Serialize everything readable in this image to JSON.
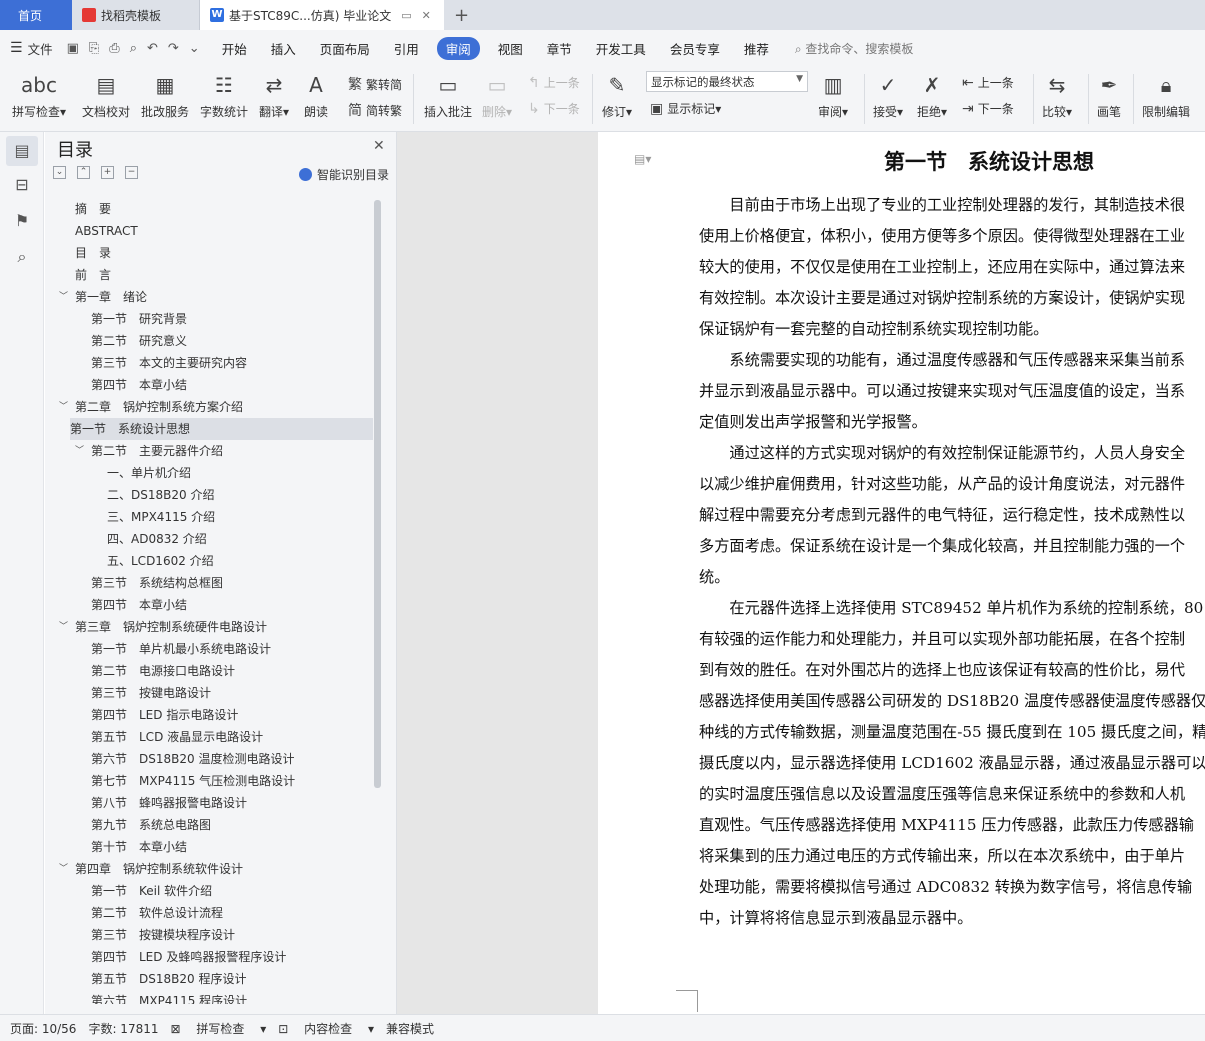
{
  "tabs": {
    "home": "首页",
    "daoke": "找稻壳模板",
    "doc": "基于STC89C...仿真)  毕业论文",
    "add": "+"
  },
  "menu": {
    "file": "文件",
    "items": [
      "开始",
      "插入",
      "页面布局",
      "引用",
      "审阅",
      "视图",
      "章节",
      "开发工具",
      "会员专享",
      "推荐"
    ],
    "active": "审阅",
    "search": "查找命令、搜索模板"
  },
  "ribbon": {
    "spell": "拼写检查",
    "doccheck": "文档校对",
    "batch": "批改服务",
    "wordcount": "字数统计",
    "translate": "翻译",
    "read": "朗读",
    "trad": "繁转简",
    "simp": "简转繁",
    "insert_comment": "插入批注",
    "delete": "删除",
    "prev": "上一条",
    "next": "下一条",
    "revise": "修订",
    "markup_state": "显示标记的最终状态",
    "show_markup": "显示标记",
    "review": "审阅",
    "accept": "接受",
    "reject": "拒绝",
    "prev2": "上一条",
    "next2": "下一条",
    "compare": "比较",
    "pen": "画笔",
    "restrict": "限制编辑"
  },
  "toc": {
    "title": "目录",
    "smart": "智能识别目录",
    "items": [
      {
        "text": "摘　要",
        "level": 0
      },
      {
        "text": "ABSTRACT",
        "level": 0
      },
      {
        "text": "目　录",
        "level": 0
      },
      {
        "text": "前　言",
        "level": 0
      },
      {
        "text": "第一章　绪论",
        "level": 0,
        "expander": true
      },
      {
        "text": "第一节　研究背景",
        "level": 1
      },
      {
        "text": "第二节　研究意义",
        "level": 1
      },
      {
        "text": "第三节　本文的主要研究内容",
        "level": 1
      },
      {
        "text": "第四节　本章小结",
        "level": 1
      },
      {
        "text": "第二章　锅炉控制系统方案介绍",
        "level": 0,
        "expander": true
      },
      {
        "text": "第一节　系统设计思想",
        "level": 1,
        "selected": true
      },
      {
        "text": "第二节　主要元器件介绍",
        "level": 1,
        "expander": true
      },
      {
        "text": "一、单片机介绍",
        "level": 2
      },
      {
        "text": "二、DS18B20 介绍",
        "level": 2
      },
      {
        "text": "三、MPX4115 介绍",
        "level": 2
      },
      {
        "text": "四、AD0832 介绍",
        "level": 2
      },
      {
        "text": "五、LCD1602 介绍",
        "level": 2
      },
      {
        "text": "第三节　系统结构总框图",
        "level": 1
      },
      {
        "text": "第四节　本章小结",
        "level": 1
      },
      {
        "text": "第三章　锅炉控制系统硬件电路设计",
        "level": 0,
        "expander": true
      },
      {
        "text": "第一节　单片机最小系统电路设计",
        "level": 1
      },
      {
        "text": "第二节　电源接口电路设计",
        "level": 1
      },
      {
        "text": "第三节　按键电路设计",
        "level": 1
      },
      {
        "text": "第四节　LED 指示电路设计",
        "level": 1
      },
      {
        "text": "第五节　LCD 液晶显示电路设计",
        "level": 1
      },
      {
        "text": "第六节　DS18B20 温度检测电路设计",
        "level": 1
      },
      {
        "text": "第七节　MXP4115 气压检测电路设计",
        "level": 1
      },
      {
        "text": "第八节　蜂鸣器报警电路设计",
        "level": 1
      },
      {
        "text": "第九节　系统总电路图",
        "level": 1
      },
      {
        "text": "第十节　本章小结",
        "level": 1
      },
      {
        "text": "第四章　锅炉控制系统软件设计",
        "level": 0,
        "expander": true
      },
      {
        "text": "第一节　Keil 软件介绍",
        "level": 1
      },
      {
        "text": "第二节　软件总设计流程",
        "level": 1
      },
      {
        "text": "第三节　按键模块程序设计",
        "level": 1
      },
      {
        "text": "第四节　LED 及蜂鸣器报警程序设计",
        "level": 1
      },
      {
        "text": "第五节　DS18B20 程序设计",
        "level": 1
      },
      {
        "text": "第六节　MXP4115 程序设计",
        "level": 1
      }
    ]
  },
  "document": {
    "heading": "第一节　系统设计思想",
    "lines": [
      "　　目前由于市场上出现了专业的工业控制处理器的发行，其制造技术很",
      "使用上价格便宜，体积小，使用方便等多个原因。使得微型处理器在工业",
      "较大的使用，不仅仅是使用在工业控制上，还应用在实际中，通过算法来",
      "有效控制。本次设计主要是通过对锅炉控制系统的方案设计，使锅炉实现",
      "保证锅炉有一套完整的自动控制系统实现控制功能。",
      "　　系统需要实现的功能有，通过温度传感器和气压传感器来采集当前系",
      "并显示到液晶显示器中。可以通过按键来实现对气压温度值的设定，当系",
      "定值则发出声学报警和光学报警。",
      "　　通过这样的方式实现对锅炉的有效控制保证能源节约，人员人身安全",
      "以减少维护雇佣费用，针对这些功能，从产品的设计角度说法，对元器件",
      "解过程中需要充分考虑到元器件的电气特征，运行稳定性，技术成熟性以",
      "多方面考虑。保证系统在设计是一个集成化较高，并且控制能力强的一个",
      "统。",
      "　　在元器件选择上选择使用 STC89452 单片机作为系统的控制系统，80",
      "有较强的运作能力和处理能力，并且可以实现外部功能拓展，在各个控制",
      "到有效的胜任。在对外围芯片的选择上也应该保证有较高的性价比，易代",
      "感器选择使用美国传感器公司研发的 DS18B20 温度传感器使温度传感器仅",
      "种线的方式传输数据，测量温度范围在-55 摄氏度到在 105 摄氏度之间，精",
      "摄氏度以内，显示器选择使用 LCD1602 液晶显示器，通过液晶显示器可以",
      "的实时温度压强信息以及设置温度压强等信息来保证系统中的参数和人机",
      "直观性。气压传感器选择使用 MXP4115 压力传感器，此款压力传感器输",
      "将采集到的压力通过电压的方式传输出来，所以在本次系统中，由于单片",
      "处理功能，需要将模拟信号通过 ADC0832 转换为数字信号，将信息传输",
      "中，计算将将信息显示到液晶显示器中。"
    ]
  },
  "status": {
    "page": "页面: 10/56",
    "words": "字数: 17811",
    "spell": "拼写检查",
    "content": "内容检查",
    "compat": "兼容模式"
  }
}
